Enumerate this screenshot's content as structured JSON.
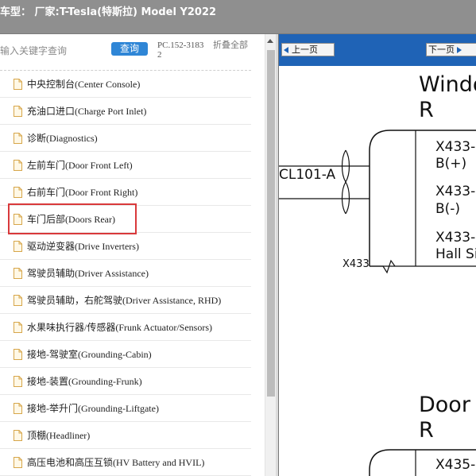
{
  "header": {
    "title": "车型：  厂家:T-Tesla(特斯拉) Model Y2022"
  },
  "search": {
    "placeholder": "输入关键字查询",
    "query_label": "查询",
    "pc_code": "PC.152-31832",
    "collapse_all": "折叠全部"
  },
  "tree": {
    "items": [
      {
        "label": "中央控制台(Center Console)"
      },
      {
        "label": "充油口进口(Charge Port Inlet)"
      },
      {
        "label": "诊断(Diagnostics)"
      },
      {
        "label": "左前车门(Door Front Left)"
      },
      {
        "label": "右前车门(Door Front Right)"
      },
      {
        "label": "车门后部(Doors Rear)"
      },
      {
        "label": "驱动逆变器(Drive Inverters)"
      },
      {
        "label": "驾驶员辅助(Driver Assistance)"
      },
      {
        "label": "驾驶员辅助，右舵驾驶(Driver Assistance, RHD)"
      },
      {
        "label": "水果味执行器/传感器(Frunk Actuator/Sensors)"
      },
      {
        "label": "接地-驾驶室(Grounding-Cabin)"
      },
      {
        "label": "接地-装置(Grounding-Frunk)"
      },
      {
        "label": "接地-举升门(Grounding-Liftgate)"
      },
      {
        "label": "顶棚(Headliner)"
      },
      {
        "label": "高压电池和高压互锁(HV Battery and HVIL)"
      }
    ],
    "selected_index": 5
  },
  "nav": {
    "prev_label": "上一页",
    "next_label": "下一页"
  },
  "diagram": {
    "title1_line1": "Windo",
    "title1_line2": "R",
    "connector_left": "CL101-A",
    "pin1_line1": "X433-",
    "pin1_line2": "B(+)",
    "pin2_line1": "X433-",
    "pin2_line2": "B(-)",
    "pin3_line1": "X433-",
    "pin3_line2": "Hall Si",
    "connector_tag": "X433",
    "title2_line1": "Door",
    "title2_line2": "R",
    "pin4_line1": "X435-"
  },
  "colors": {
    "header_bg": "#8f8f8f",
    "nav_bg": "#1f63b6",
    "query_btn": "#2f86d6",
    "highlight": "#d9393b"
  }
}
